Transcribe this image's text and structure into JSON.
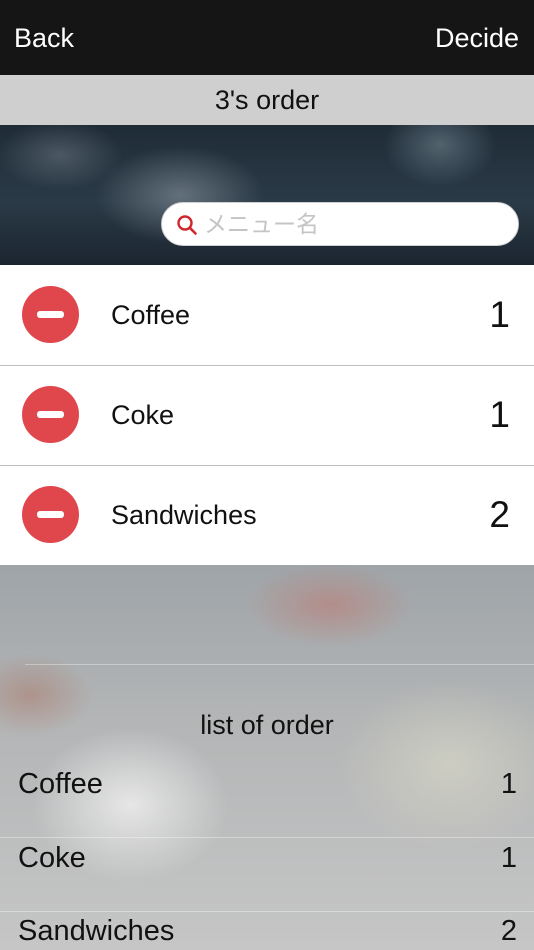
{
  "nav": {
    "back_label": "Back",
    "decide_label": "Decide"
  },
  "title": "3's order",
  "search": {
    "placeholder": "メニュー名",
    "value": ""
  },
  "order_items": [
    {
      "name": "Coffee",
      "qty": "1"
    },
    {
      "name": "Coke",
      "qty": "1"
    },
    {
      "name": "Sandwiches",
      "qty": "2"
    }
  ],
  "summary": {
    "heading": "list of order",
    "rows": [
      {
        "name": "Coffee",
        "qty": "1"
      },
      {
        "name": "Coke",
        "qty": "1"
      },
      {
        "name": "Sandwiches",
        "qty": "2"
      }
    ]
  },
  "colors": {
    "navbar": "#151515",
    "title_band": "#cfcfcf",
    "remove_button": "#e0474c",
    "search_icon": "#d0272d"
  },
  "icons": {
    "search": "search-icon",
    "remove": "minus-circle-icon"
  }
}
